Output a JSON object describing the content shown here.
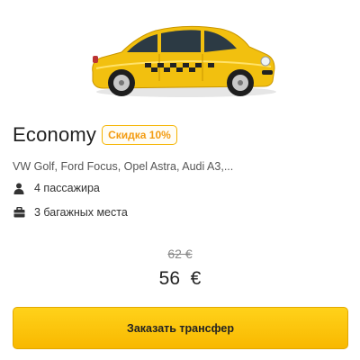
{
  "car": {
    "image_name": "taxi-car-image"
  },
  "tariff": {
    "title": "Economy",
    "discount_badge": "Скидка 10%",
    "models": "VW Golf, Ford Focus, Opel Astra, Audi A3,...",
    "passengers": "4 пассажира",
    "luggage": "3 багажных места"
  },
  "price": {
    "old": "62 €",
    "new": "56  €"
  },
  "order_button": {
    "label": "Заказать трансфер"
  },
  "icons": {
    "passengers": "person-icon",
    "luggage": "suitcase-icon"
  },
  "colors": {
    "accent": "#f5b400",
    "badge_text": "#f39c12",
    "button": "#ffcc00"
  }
}
